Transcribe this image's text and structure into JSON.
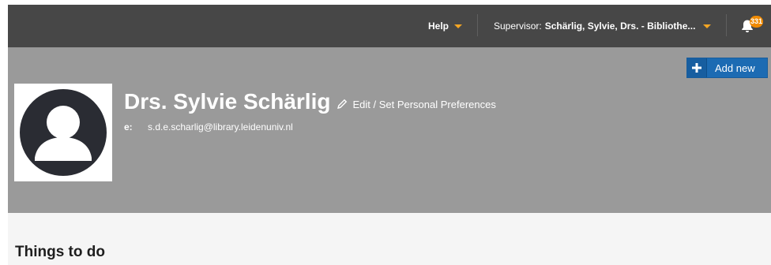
{
  "topbar": {
    "help_label": "Help",
    "supervisor_prefix": "Supervisor:",
    "supervisor_name": "Schärlig, Sylvie, Drs. - Bibliothe...",
    "notification_count": "331"
  },
  "profile": {
    "add_new_label": "Add new",
    "name": "Drs. Sylvie Schärlig",
    "edit_label": "Edit / Set Personal Preferences",
    "email_label": "e:",
    "email": "s.d.e.scharlig@library.leidenuniv.nl"
  },
  "section": {
    "title": "Things to do"
  },
  "colors": {
    "topbar_bg": "#474747",
    "profile_bg": "#9a9a9a",
    "accent_orange": "#f5a623",
    "button_blue": "#1c6bb3"
  },
  "icons": [
    "chevron-down-icon",
    "bell-icon",
    "plus-icon",
    "pencil-icon",
    "user-avatar-icon"
  ]
}
